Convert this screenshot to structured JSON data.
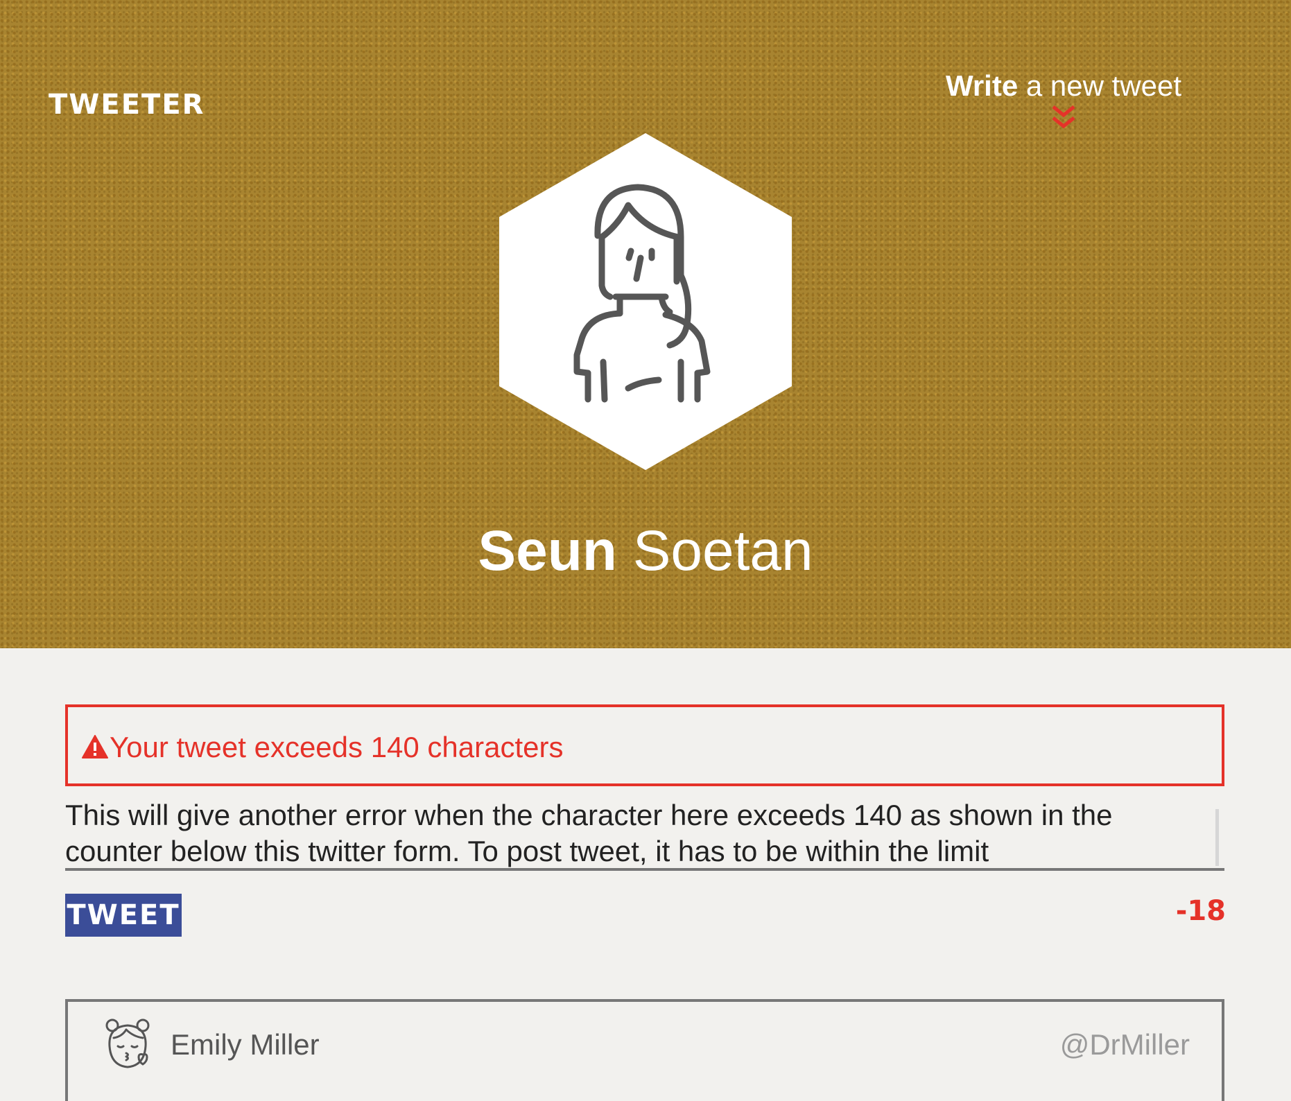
{
  "header": {
    "brand": "TWEETER",
    "write_link": {
      "strong": "Write",
      "rest": " a new tweet",
      "icon": "chevron-double-down-icon"
    },
    "avatar_icon": "female-user-icon",
    "profile": {
      "first_name": "Seun",
      "last_name": "Soetan"
    }
  },
  "composer": {
    "error": {
      "icon": "warning-icon",
      "message": "Your tweet exceeds 140 characters"
    },
    "text": "This will give another error when the character here exceeds 140 as shown in the counter below this twitter form. To post tweet, it has to be within the limit",
    "tweet_button": "TWEET",
    "counter": "-18"
  },
  "tweets": [
    {
      "avatar_icon": "kissing-girl-icon",
      "name": "Emily Miller",
      "handle": "@DrMiller"
    }
  ],
  "colors": {
    "header_bg": "#a88430",
    "error": "#e53229",
    "tweet_button": "#3b4d98",
    "content_bg": "#f2f1ee"
  }
}
